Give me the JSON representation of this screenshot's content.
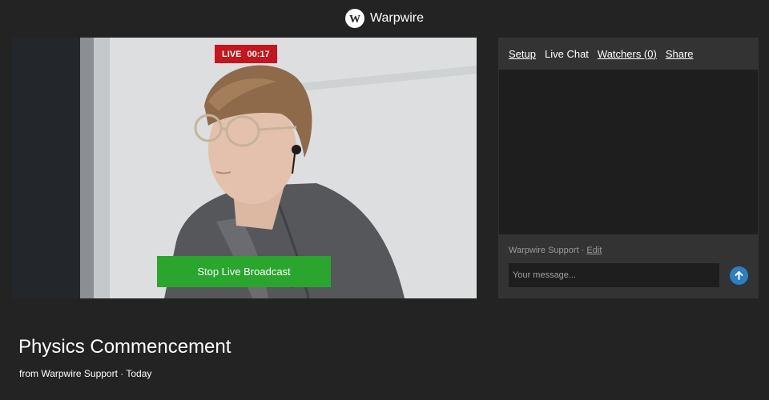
{
  "header": {
    "brand_name": "Warpwire",
    "logo_letter": "W"
  },
  "video": {
    "live_label": "LIVE",
    "elapsed": "00:17",
    "stop_button_label": "Stop Live Broadcast"
  },
  "chat_panel": {
    "tabs": [
      {
        "label": "Setup",
        "active": false
      },
      {
        "label": "Live Chat",
        "active": true
      },
      {
        "label": "Watchers (0)",
        "active": false
      },
      {
        "label": "Share",
        "active": false
      }
    ],
    "user_name": "Warpwire Support",
    "separator": "·",
    "edit_label": "Edit",
    "message_placeholder": "Your message..."
  },
  "event": {
    "title": "Physics Commencement",
    "meta": "from Warpwire Support · Today"
  },
  "colors": {
    "live_badge": "#c4161c",
    "stop_button": "#2aa52e",
    "send_button": "#2b7fc4",
    "page_background": "#232323"
  }
}
